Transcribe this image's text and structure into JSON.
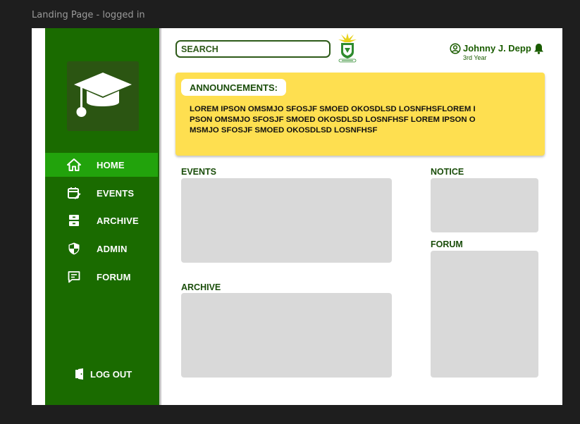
{
  "frame_label": "Landing Page - logged in",
  "sidebar": {
    "logo_icon": "graduation-cap-icon",
    "items": [
      {
        "label": "HOME",
        "icon": "home-icon",
        "active": true
      },
      {
        "label": "EVENTS",
        "icon": "calendar-edit-icon",
        "active": false
      },
      {
        "label": "ARCHIVE",
        "icon": "archive-icon",
        "active": false
      },
      {
        "label": "ADMIN",
        "icon": "shield-icon",
        "active": false
      },
      {
        "label": "FORUM",
        "icon": "chat-icon",
        "active": false
      }
    ],
    "logout_label": "LOG OUT",
    "logout_icon": "door-exit-icon"
  },
  "header": {
    "search_placeholder": "SEARCH",
    "crest_icon": "school-crest-icon",
    "user_name": "Johnny J. Depp",
    "user_year": "3rd Year",
    "user_icon": "user-circle-icon",
    "bell_icon": "bell-icon"
  },
  "announcements": {
    "title": "ANNOUNCEMENTS:",
    "body": "LOREM IPSON OMSMJO SFOSJF SMOED OKOSDLSD LOSNFHSFLOREM IPSON OMSMJO SFOSJF SMOED OKOSDLSD LOSNFHSF LOREM IPSON OMSMJO SFOSJF SMOED OKOSDLSD LOSNFHSF"
  },
  "sections": {
    "events": "EVENTS",
    "archive": "ARCHIVE",
    "notice": "NOTICE",
    "forum": "FORUM"
  },
  "colors": {
    "sidebar": "#1a6b00",
    "active_item": "#22a30c",
    "announcement": "#fedf50",
    "placeholder_panel": "#d9d9d9",
    "text_green": "#1a4d0a"
  }
}
